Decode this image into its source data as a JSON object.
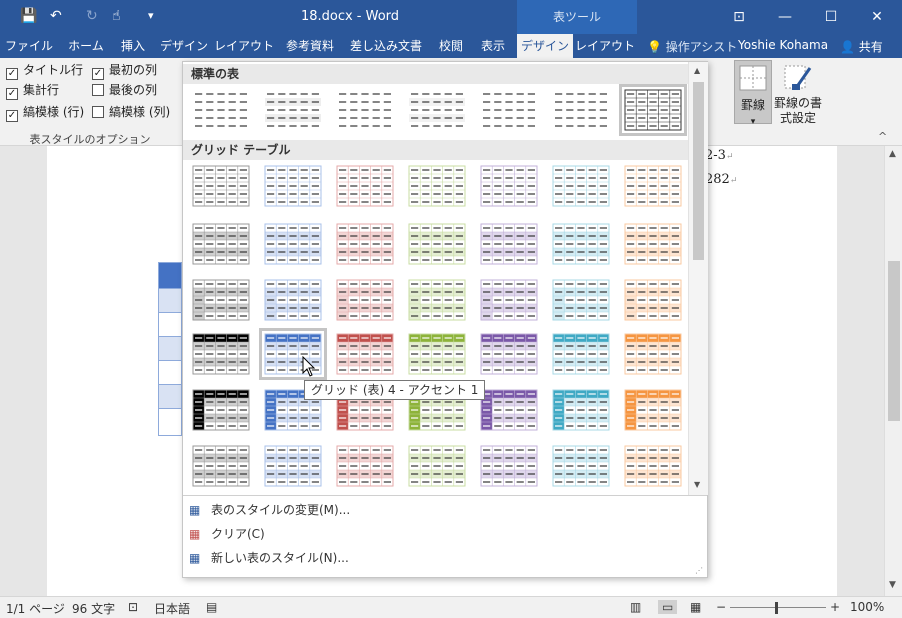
{
  "titlebar": {
    "document_title": "18.docx - Word",
    "contextual_tab_group": "表ツール"
  },
  "tabs": [
    "ファイル",
    "ホーム",
    "挿入",
    "デザイン",
    "レイアウト",
    "参考資料",
    "差し込み文書",
    "校閲",
    "表示",
    "デザイン",
    "レイアウト"
  ],
  "active_tab_index": 9,
  "tell_me": "操作アシスト",
  "user_name": "Yoshie Kohama",
  "share_label": "共有",
  "style_options": {
    "header_row": {
      "label": "タイトル行",
      "checked": true
    },
    "first_column": {
      "label": "最初の列",
      "checked": true
    },
    "total_row": {
      "label": "集計行",
      "checked": true
    },
    "last_column": {
      "label": "最後の列",
      "checked": false
    },
    "banded_rows": {
      "label": "縞模様 (行)",
      "checked": true
    },
    "banded_columns": {
      "label": "縞模様 (列)",
      "checked": false
    },
    "group_label": "表スタイルのオプション"
  },
  "borders_button": "罫線",
  "border_painter_button": "罫線の書式設定",
  "gallery": {
    "sections": {
      "plain": "標準の表",
      "grid": "グリッド テーブル"
    },
    "tooltip": "グリッド (表) 4 - アクセント 1",
    "hovered_style": {
      "row": 4,
      "col": 2
    },
    "selected_plain_index": 7,
    "accent_colors": [
      "#000000",
      "#4472c4",
      "#c0504d",
      "#8db33a",
      "#7a58a8",
      "#3fa9c4",
      "#f59541"
    ],
    "menu": [
      {
        "label": "表のスタイルの変更(M)..."
      },
      {
        "label": "クリア(C)"
      },
      {
        "label": "新しい表のスタイル(N)..."
      }
    ]
  },
  "doc_text": {
    "line1": "2-3",
    "line2": "282"
  },
  "status": {
    "page": "1/1 ページ",
    "words": "96 文字",
    "language": "日本語",
    "zoom": "100%"
  }
}
